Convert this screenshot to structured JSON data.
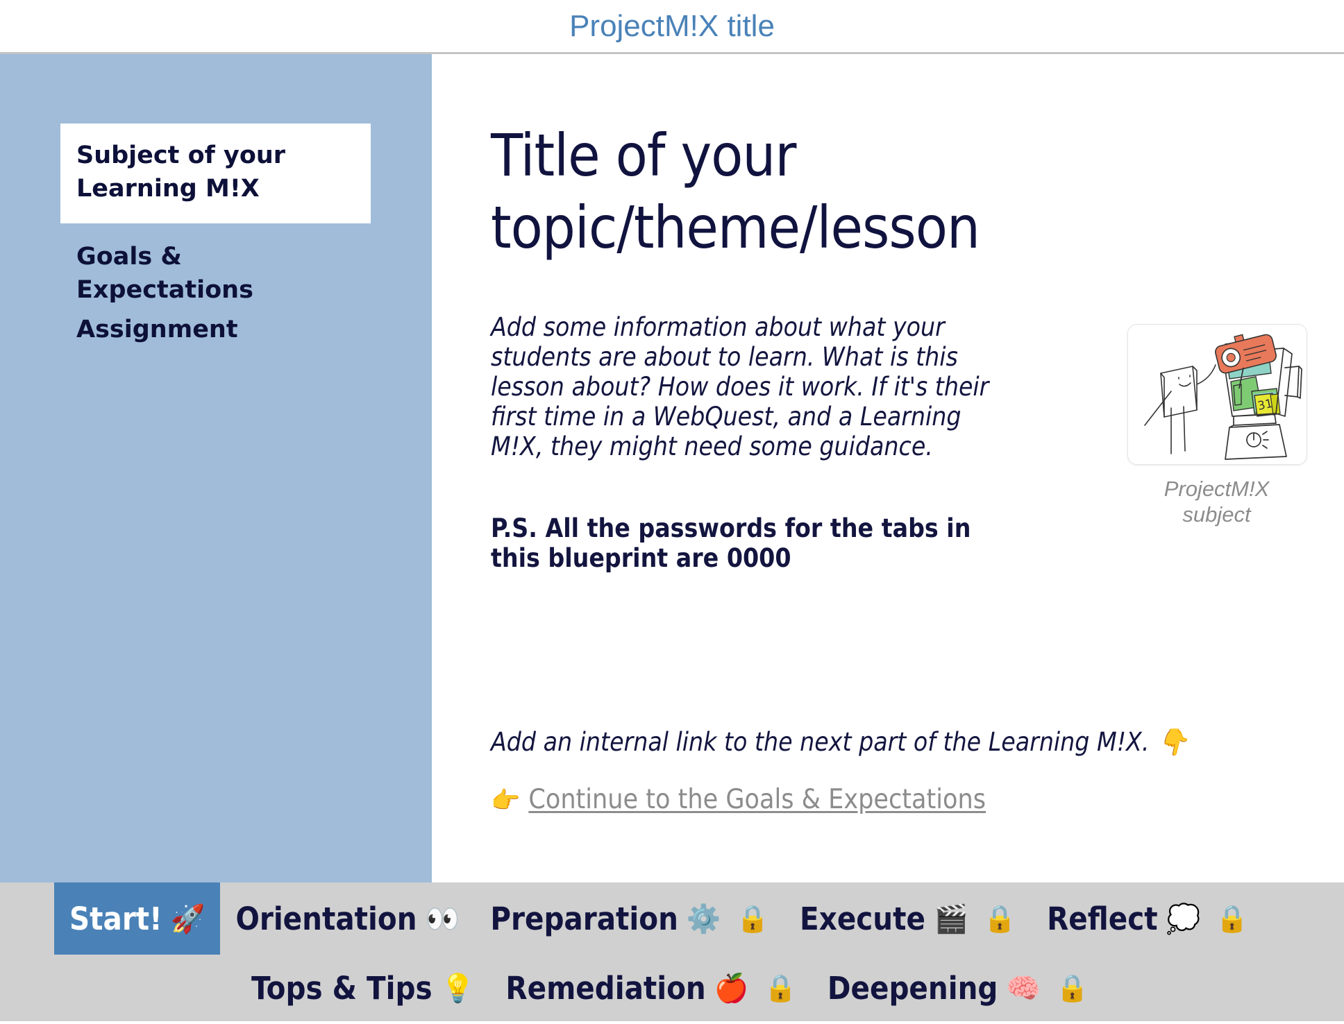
{
  "header": {
    "title": "ProjectM!X title",
    "title_color": "#4a82b8"
  },
  "sidebar": {
    "background_color": "#a0bcd9",
    "items": [
      {
        "label": "Subject of your\nLearning M!X",
        "active": true
      },
      {
        "label": "Goals &\nExpectations",
        "active": false
      },
      {
        "label": "Assignment",
        "active": false
      }
    ]
  },
  "main": {
    "title": "Title of your topic/theme/lesson",
    "body_text": "Add some information about what your students are about to learn. What is this lesson about? How does it work. If it's their first time in a WebQuest, and a Learning M!X, they might need some guidance.",
    "ps_text": "P.S. All the passwords for the tabs in this blueprint are 0000",
    "link_hint": "Add an internal link to the next part of the Learning M!X.  👇",
    "link_pointer_icon": "👉",
    "internal_link_label": "Continue to the Goals & Expectations",
    "link_color": "#8c8c8c",
    "illustration_caption": "ProjectM!X\nsubject"
  },
  "tabbar": {
    "background_color": "#d0d0d0",
    "active_color": "#4a82b8",
    "rows": [
      [
        {
          "label": "Start!",
          "emoji": "🚀",
          "lock": "",
          "active": true
        },
        {
          "label": "Orientation",
          "emoji": "👀",
          "lock": "",
          "active": false
        },
        {
          "label": "Preparation",
          "emoji": "⚙️",
          "lock": "🔒",
          "active": false
        },
        {
          "label": "Execute",
          "emoji": "🎬",
          "lock": "🔒",
          "active": false
        },
        {
          "label": "Reflect",
          "emoji": "💭",
          "lock": "🔒",
          "active": false
        }
      ],
      [
        {
          "label": "Tops & Tips",
          "emoji": "💡",
          "lock": "",
          "active": false
        },
        {
          "label": "Remediation",
          "emoji": "🍎",
          "lock": "🔒",
          "active": false
        },
        {
          "label": "Deepening",
          "emoji": "🧠",
          "lock": "🔒",
          "active": false
        }
      ]
    ]
  }
}
